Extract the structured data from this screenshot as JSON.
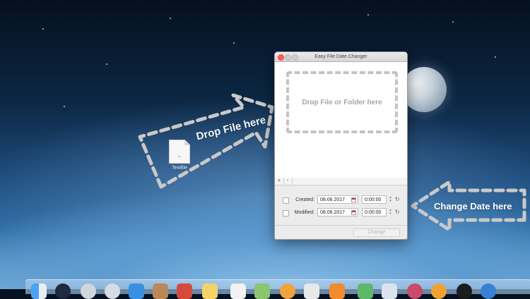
{
  "window": {
    "title": "Easy File Date Changer",
    "drop_area_text": "Drop File or Folder here",
    "add_button": "+",
    "remove_button": "-",
    "created_label": "Created:",
    "created_date": "08.06.2017",
    "created_time": "0:00:00",
    "modified_label": "Modified:",
    "modified_date": "08.06.2017",
    "modified_time": "0:00:00",
    "change_button": "Change"
  },
  "desktop": {
    "file_name": "Textfile",
    "file_ext": "txt",
    "drop_annotation": "Drop File here",
    "change_annotation": "Change Date here"
  },
  "dock": {
    "icons": [
      "finder-icon",
      "launchpad-icon",
      "safari-icon",
      "mail-icon",
      "contacts-icon",
      "calendar-icon",
      "notes-icon",
      "reminders-icon",
      "maps-icon",
      "photos-icon",
      "messages-icon",
      "facetime-icon",
      "itunes-icon",
      "ibooks-icon",
      "appstore-icon",
      "preferences-icon",
      "downloads-icon",
      "trash-icon"
    ]
  },
  "colors": {
    "close_button": "#fc5f57",
    "annotation_dash": "#c9c9c9"
  }
}
